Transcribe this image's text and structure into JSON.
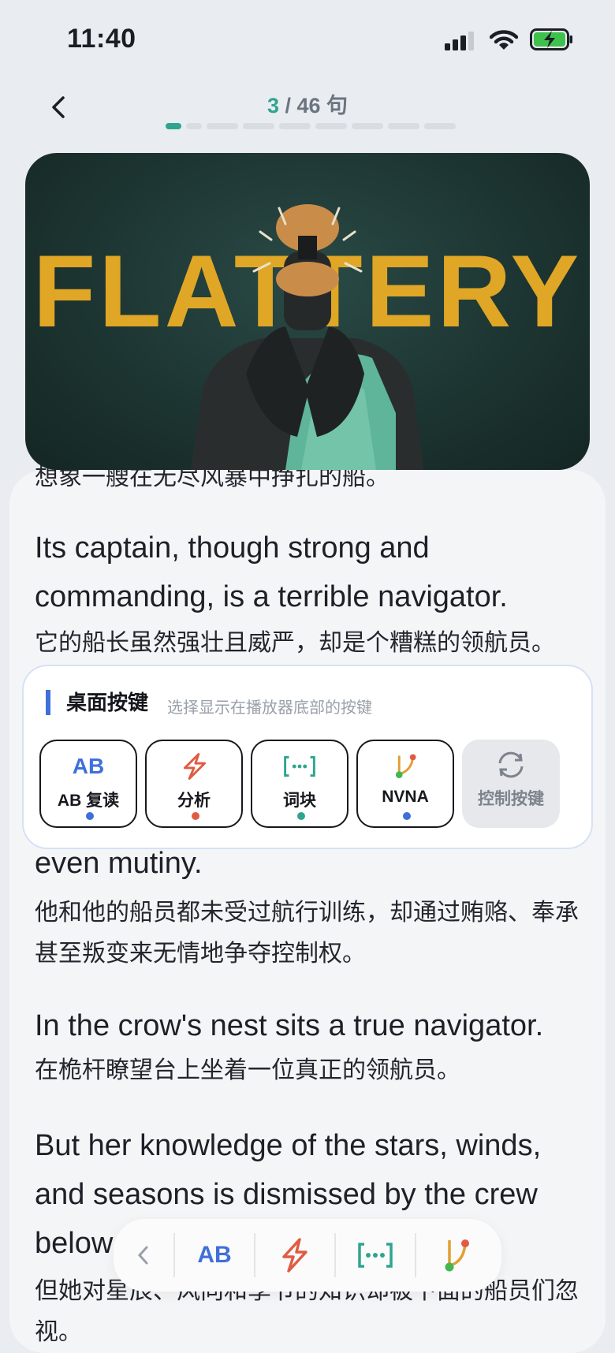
{
  "status": {
    "time": "11:40"
  },
  "nav": {
    "current": "3",
    "rest": " / 46 句",
    "segments": 9
  },
  "video": {
    "title_text": "FLATTERY"
  },
  "sentences": [
    {
      "zh": "想象一艘在无尽风暴中挣扎的船。"
    },
    {
      "en": "Its captain, though strong and commanding, is a terrible navigator.",
      "zh": "它的船长虽然强壮且威严，却是个糟糕的领航员。"
    },
    {
      "en": "even mutiny.",
      "zh": "他和他的船员都未受过航行训练，却通过贿赂、奉承甚至叛变来无情地争夺控制权。"
    },
    {
      "en": "In the crow's nest sits a true navigator.",
      "zh": "在桅杆瞭望台上坐着一位真正的领航员。"
    },
    {
      "en": "But her knowledge of the stars, winds, and seasons is dismissed by the crew below",
      "zh": "但她对星辰、风向和季节的知识却被下面的船员们忽视。"
    }
  ],
  "panel": {
    "title": "桌面按键",
    "subtitle": "选择显示在播放器底部的按键",
    "keys": [
      {
        "label": "AB 复读",
        "icon": "ab-icon",
        "dot": "#3f6fd9"
      },
      {
        "label": "分析",
        "icon": "lightning-icon",
        "dot": "#e15b43"
      },
      {
        "label": "词块",
        "icon": "chunk-bracket-icon",
        "dot": "#2fa58f"
      },
      {
        "label": "NVNA",
        "icon": "branch-icon",
        "dot": "#3f6fd9"
      },
      {
        "label": "控制按键",
        "icon": "refresh-icon",
        "dot": null
      }
    ]
  },
  "toolbar": {
    "ab_label": "AB"
  },
  "colors": {
    "accent_green": "#2fa58f",
    "accent_blue": "#3f6fd9",
    "accent_red": "#e15b43",
    "accent_orange": "#e0a030"
  }
}
